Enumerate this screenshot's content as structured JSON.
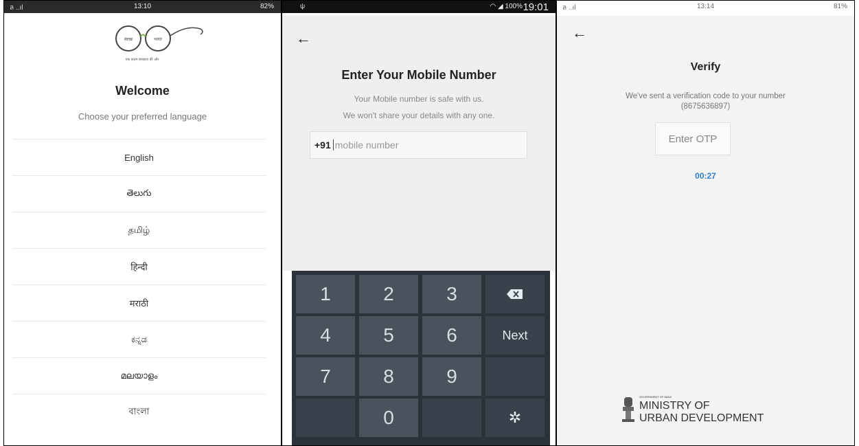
{
  "phone1": {
    "status": {
      "left": "ล ..ıl",
      "time": "13:10",
      "right": "82%"
    },
    "logo": {
      "left_text": "स्वच्छ",
      "right_text": "भारत",
      "tagline": "एक कदम स्वच्छता की ओर"
    },
    "welcome": "Welcome",
    "choose": "Choose your preferred language",
    "languages": [
      "English",
      "తెలుగు",
      "தமிழ்",
      "हिन्दी",
      "मराठी",
      "ಕನ್ನಡ",
      "മലയാളം",
      "বাংলা"
    ]
  },
  "phone2": {
    "status": {
      "left": "ψ",
      "right": "100%",
      "time": "19:01"
    },
    "title": "Enter Your Mobile Number",
    "safe_line1": "Your Mobile number is safe with us.",
    "safe_line2": "We won't share your details with any one.",
    "country_code": "+91",
    "input_placeholder": "mobile number",
    "keys": {
      "k1": "1",
      "k2": "2",
      "k3": "3",
      "k4": "4",
      "k5": "5",
      "k6": "6",
      "k7": "7",
      "k8": "8",
      "k9": "9",
      "k0": "0",
      "next": "Next"
    }
  },
  "phone3": {
    "status": {
      "left": "ล ..ıl",
      "time": "13:14",
      "right": "81%"
    },
    "title": "Verify",
    "sent_text": "We've sent a verification code to your number",
    "phone": "(8675636897)",
    "otp_placeholder": "Enter OTP",
    "timer": "00:27",
    "ministry_govt": "GOVERNMENT OF INDIA",
    "ministry_line1": "MINISTRY OF",
    "ministry_line2": "URBAN DEVELOPMENT"
  }
}
